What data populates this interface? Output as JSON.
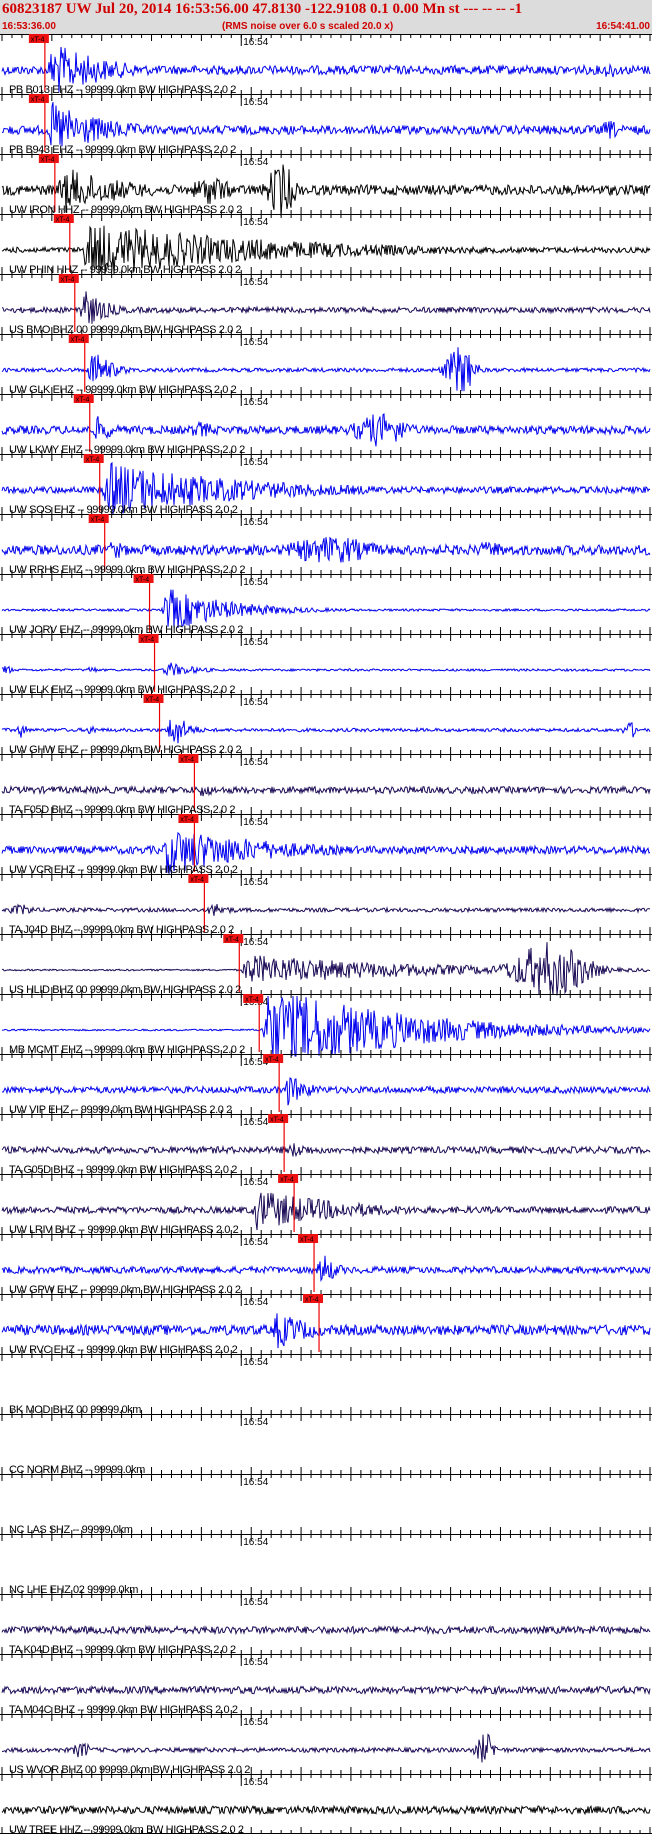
{
  "header": {
    "title": "60823187 UW Jul 20, 2014 16:53:56.00   47.8130 -122.9108  0.1 0.00 Mn st --- -- --   -1",
    "start_time": "16:53:36.00",
    "noise_note": "(RMS noise over 6.0 s scaled 20.0 x)",
    "end_time": "16:54:41.00"
  },
  "colors": {
    "header_bg": "#dcdcdc",
    "header_text": "#d00000",
    "pick_fill": "#ee1111",
    "pick_line": "#ee0000",
    "trace_blue": "#0000ee",
    "trace_black": "#000000",
    "trace_navy": "#1a0a55",
    "axis": "#000000"
  },
  "chart_data": {
    "type": "seismogram",
    "time_range": [
      "16:53:36.00",
      "16:54:41.00"
    ],
    "minute_label": "16:54",
    "pick_label": "xT-4",
    "traces": [
      {
        "label": "PB B013 EHZ -- 99999.0km BW  HIGHPASS  2.0  2",
        "color": "blue",
        "pick_s": 4.0,
        "amp": 0.16,
        "event": [
          [
            4.5,
            12,
            1.0
          ]
        ],
        "bursts": [
          [
            61,
            2,
            0.3
          ]
        ]
      },
      {
        "label": "PB B943 EHZ -- 99999.0km BW  HIGHPASS  2.0  2",
        "color": "blue",
        "pick_s": 4.0,
        "amp": 0.16,
        "event": [
          [
            4.5,
            12,
            1.0
          ]
        ],
        "bursts": [
          [
            61,
            2,
            0.35
          ]
        ]
      },
      {
        "label": "UW IRON HHZ -- 99999.0km BW  HIGHPASS  2.0  2",
        "color": "black",
        "pick_s": 5.0,
        "amp": 0.18,
        "event": [
          [
            5.5,
            14,
            0.85
          ]
        ],
        "bursts": [
          [
            21,
            4,
            0.55
          ],
          [
            28,
            3,
            1.0
          ]
        ]
      },
      {
        "label": "UW PHIN HHZ -- 99999.0km BW  HIGHPASS  2.0  2",
        "color": "black",
        "pick_s": 6.5,
        "amp": 0.1,
        "event": [
          [
            8,
            40,
            1.0
          ]
        ],
        "bursts": []
      },
      {
        "label": "US BMO BHZ 00 99999.0km BW  HIGHPASS  2.0  2",
        "color": "navy",
        "pick_s": 7.0,
        "amp": 0.1,
        "event": [
          [
            7.5,
            5,
            0.8
          ]
        ],
        "bursts": []
      },
      {
        "label": "UW GLK EHZ -- 99999.0km BW  HIGHPASS  2.0  2",
        "color": "blue",
        "pick_s": 8.0,
        "amp": 0.07,
        "event": [
          [
            8.5,
            4,
            0.8
          ]
        ],
        "bursts": [
          [
            46,
            3,
            0.9
          ]
        ]
      },
      {
        "label": "UW LKWY EHZ -- 99999.0km BW  HIGHPASS  2.0  2",
        "color": "blue",
        "pick_s": 8.5,
        "amp": 0.15,
        "event": [
          [
            9,
            4,
            0.5
          ]
        ],
        "bursts": [
          [
            20,
            3,
            0.3
          ],
          [
            38,
            6,
            0.6
          ]
        ]
      },
      {
        "label": "UW SOS EHZ -- 99999.0km BW  HIGHPASS  2.0  2",
        "color": "blue",
        "pick_s": 9.5,
        "amp": 0.12,
        "event": [
          [
            10,
            30,
            1.0
          ]
        ],
        "bursts": []
      },
      {
        "label": "UW RRHS EHZ -- 99999.0km BW  HIGHPASS  2.0  2",
        "color": "blue",
        "pick_s": 10.0,
        "amp": 0.18,
        "event": [
          [
            10.5,
            4,
            0.4
          ]
        ],
        "bursts": [
          [
            33,
            10,
            0.5
          ],
          [
            49,
            4,
            0.3
          ]
        ]
      },
      {
        "label": "UW JORV EHZ -- 99999.0km BW  HIGHPASS  2.0  2",
        "color": "blue",
        "pick_s": 14.5,
        "amp": 0.04,
        "event": [
          [
            16,
            14,
            0.8
          ]
        ],
        "bursts": []
      },
      {
        "label": "UW ELK EHZ -- 99999.0km BW  HIGHPASS  2.0  2",
        "color": "blue",
        "pick_s": 15.0,
        "amp": 0.04,
        "event": [
          [
            16,
            6,
            0.3
          ]
        ],
        "bursts": [
          [
            0.5,
            1,
            0.2
          ],
          [
            9,
            1,
            0.15
          ]
        ]
      },
      {
        "label": "UW GHW EHZ -- 99999.0km BW  HIGHPASS  2.0  2",
        "color": "blue",
        "pick_s": 15.5,
        "amp": 0.06,
        "event": [
          [
            16.5,
            3,
            0.8
          ]
        ],
        "bursts": [
          [
            2,
            1,
            0.3
          ],
          [
            9,
            1,
            0.2
          ],
          [
            63,
            1.5,
            0.3
          ]
        ]
      },
      {
        "label": "TA F05D BHZ -- 99999.0km BW  HIGHPASS  2.0  2",
        "color": "navy",
        "pick_s": 19.0,
        "amp": 0.12,
        "event": [
          [
            19.5,
            3,
            0.3
          ]
        ],
        "bursts": []
      },
      {
        "label": "UW VCR EHZ -- 99999.0km BW  HIGHPASS  2.0  2",
        "color": "blue",
        "pick_s": 19.0,
        "amp": 0.14,
        "event": [
          [
            16,
            22,
            0.9
          ]
        ],
        "bursts": []
      },
      {
        "label": "TA J04D BHZ -- 99999.0km BW  HIGHPASS  2.0  2",
        "color": "navy",
        "pick_s": 20.0,
        "amp": 0.07,
        "event": [
          [
            20.5,
            4,
            0.3
          ]
        ],
        "bursts": [
          [
            2,
            3,
            0.2
          ]
        ]
      },
      {
        "label": "US HLID BHZ 00 99999.0km BW  HIGHPASS  2.0  2",
        "color": "navy",
        "pick_s": 23.5,
        "amp": 0.03,
        "event": [
          [
            24,
            40,
            0.55
          ]
        ],
        "bursts": [
          [
            55,
            8,
            1.0
          ]
        ]
      },
      {
        "label": "MB MCMT EHZ -- 99999.0km BW  HIGHPASS  2.0  2",
        "color": "blue",
        "pick_s": 25.5,
        "amp": 0.03,
        "event": [
          [
            26,
            30,
            1.6
          ]
        ],
        "bursts": []
      },
      {
        "label": "UW VIP EHZ -- 99999.0km BW  HIGHPASS  2.0  2",
        "color": "blue",
        "pick_s": 27.5,
        "amp": 0.12,
        "event": [
          [
            28,
            5,
            0.6
          ]
        ],
        "bursts": []
      },
      {
        "label": "TA G05D BHZ -- 99999.0km BW  HIGHPASS  2.0  2",
        "color": "navy",
        "pick_s": 28.0,
        "amp": 0.12,
        "event": [
          [
            28.5,
            6,
            0.3
          ]
        ],
        "bursts": []
      },
      {
        "label": "UW LRIV BHZ -- 99999.0km BW  HIGHPASS  2.0  2",
        "color": "navy",
        "pick_s": 29.0,
        "amp": 0.12,
        "event": [
          [
            25,
            20,
            0.75
          ]
        ],
        "bursts": []
      },
      {
        "label": "UW GPW EHZ -- 99999.0km BW  HIGHPASS  2.0  2",
        "color": "blue",
        "pick_s": 31.0,
        "amp": 0.12,
        "event": [
          [
            31.5,
            3,
            0.7
          ]
        ],
        "bursts": []
      },
      {
        "label": "UW RVC EHZ -- 99999.0km BW  HIGHPASS  2.0  2",
        "color": "blue",
        "pick_s": 31.5,
        "amp": 0.18,
        "event": [
          [
            27,
            8,
            0.7
          ]
        ],
        "bursts": []
      },
      {
        "label": "BK MOD BHZ 00 99999.0km",
        "color": "none",
        "pick_s": null,
        "amp": 0,
        "event": [],
        "bursts": []
      },
      {
        "label": "CC NORM BHZ -- 99999.0km",
        "color": "none",
        "pick_s": null,
        "amp": 0,
        "event": [],
        "bursts": []
      },
      {
        "label": "NC LAS SHZ -- 99999.0km",
        "color": "none",
        "pick_s": null,
        "amp": 0,
        "event": [],
        "bursts": []
      },
      {
        "label": "NC LHE EHZ 02 99999.0km",
        "color": "none",
        "pick_s": null,
        "amp": 0,
        "event": [],
        "bursts": []
      },
      {
        "label": "TA K04D BHZ -- 99999.0km BW  HIGHPASS  2.0  2",
        "color": "navy",
        "pick_s": null,
        "amp": 0.13,
        "event": [],
        "bursts": []
      },
      {
        "label": "TA M04C BHZ -- 99999.0km BW  HIGHPASS  2.0  2",
        "color": "navy",
        "pick_s": null,
        "amp": 0.13,
        "event": [],
        "bursts": []
      },
      {
        "label": "US WVOR BHZ 00 99999.0km BW  HIGHPASS  2.0  2",
        "color": "navy",
        "pick_s": null,
        "amp": 0.08,
        "event": [],
        "bursts": [
          [
            8,
            2,
            0.3
          ],
          [
            48.5,
            2,
            0.6
          ]
        ]
      },
      {
        "label": "UW TREE HHZ -- 99999.0km BW  HIGHPASS  2.0  2",
        "color": "black",
        "pick_s": null,
        "amp": 0.14,
        "event": [],
        "bursts": []
      }
    ]
  }
}
